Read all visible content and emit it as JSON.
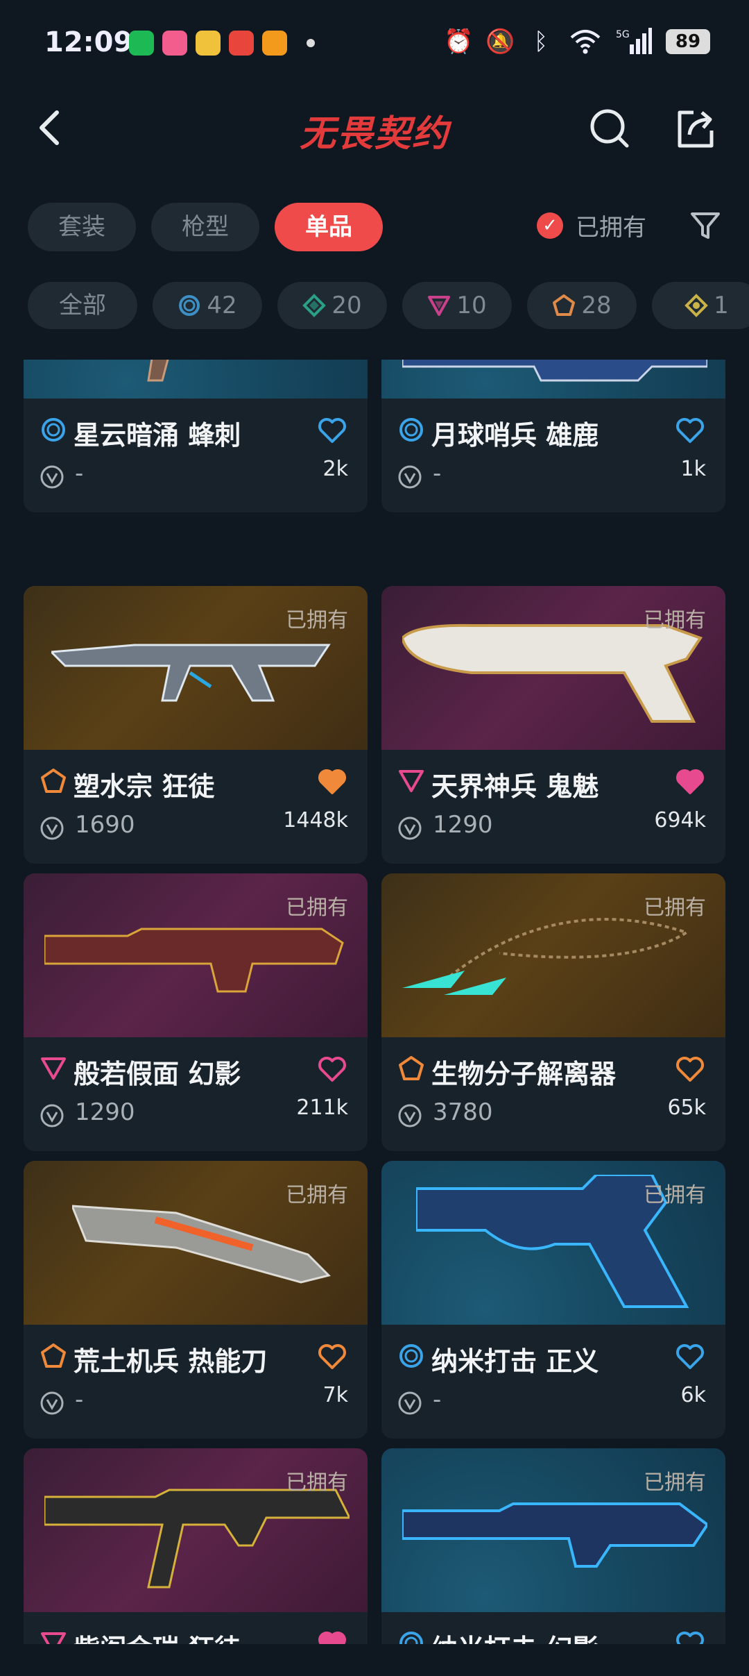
{
  "status_bar": {
    "time": "12:09",
    "battery": "89",
    "network": "5G"
  },
  "header": {
    "title": "无畏契约"
  },
  "tabs": [
    {
      "label": "套装"
    },
    {
      "label": "枪型"
    },
    {
      "label": "单品",
      "active": true
    }
  ],
  "owned_filter": {
    "label": "已拥有",
    "checked": true
  },
  "rarity_chips": [
    {
      "label": "全部"
    },
    {
      "label": "42",
      "icon": "select-tier-icon",
      "color": "#3d8fc4"
    },
    {
      "label": "20",
      "icon": "deluxe-tier-icon",
      "color": "#2aa187"
    },
    {
      "label": "10",
      "icon": "premium-tier-icon",
      "color": "#c9418a"
    },
    {
      "label": "28",
      "icon": "exclusive-tier-icon",
      "color": "#e08a4a"
    },
    {
      "label": "1",
      "icon": "ultra-tier-icon",
      "color": "#c9b247"
    }
  ],
  "items": [
    {
      "name": "星云暗涌 蜂刺",
      "price": "-",
      "likes": "2k",
      "tier": "select",
      "bg": "blue",
      "owned": false,
      "heart_filled": false,
      "heart_color": "#3ba3e8"
    },
    {
      "name": "月球哨兵 雄鹿",
      "price": "-",
      "likes": "1k",
      "tier": "select",
      "bg": "blue",
      "owned": false,
      "heart_filled": false,
      "heart_color": "#3ba3e8"
    },
    {
      "name": "塑水宗 狂徒",
      "price": "1690",
      "likes": "1448k",
      "tier": "exclusive",
      "bg": "orange",
      "owned": true,
      "owned_label": "已拥有",
      "heart_filled": true,
      "heart_color": "#f08a3a"
    },
    {
      "name": "天界神兵 鬼魅",
      "price": "1290",
      "likes": "694k",
      "tier": "premium",
      "bg": "purple",
      "owned": true,
      "owned_label": "已拥有",
      "heart_filled": true,
      "heart_color": "#e84a90"
    },
    {
      "name": "般若假面 幻影",
      "price": "1290",
      "likes": "211k",
      "tier": "premium",
      "bg": "purple",
      "owned": true,
      "owned_label": "已拥有",
      "heart_filled": false,
      "heart_color": "#e84a90"
    },
    {
      "name": "生物分子解离器",
      "price": "3780",
      "likes": "65k",
      "tier": "exclusive",
      "bg": "orange",
      "owned": true,
      "owned_label": "已拥有",
      "heart_filled": false,
      "heart_color": "#f08a3a"
    },
    {
      "name": "荒土机兵 热能刀",
      "price": "-",
      "likes": "7k",
      "tier": "exclusive",
      "bg": "orange",
      "owned": true,
      "owned_label": "已拥有",
      "heart_filled": false,
      "heart_color": "#f08a3a"
    },
    {
      "name": "纳米打击 正义",
      "price": "-",
      "likes": "6k",
      "tier": "select",
      "bg": "blue",
      "owned": true,
      "owned_label": "已拥有",
      "heart_filled": false,
      "heart_color": "#3ba3e8"
    },
    {
      "name": "紫阎金瑞 狂徒",
      "price": "",
      "likes": "",
      "tier": "premium",
      "bg": "purple",
      "owned": true,
      "owned_label": "已拥有",
      "heart_filled": true,
      "heart_color": "#e84a90"
    },
    {
      "name": "纳米打击 幻影",
      "price": "",
      "likes": "",
      "tier": "select",
      "bg": "blue",
      "owned": true,
      "owned_label": "已拥有",
      "heart_filled": false,
      "heart_color": "#3ba3e8"
    }
  ]
}
